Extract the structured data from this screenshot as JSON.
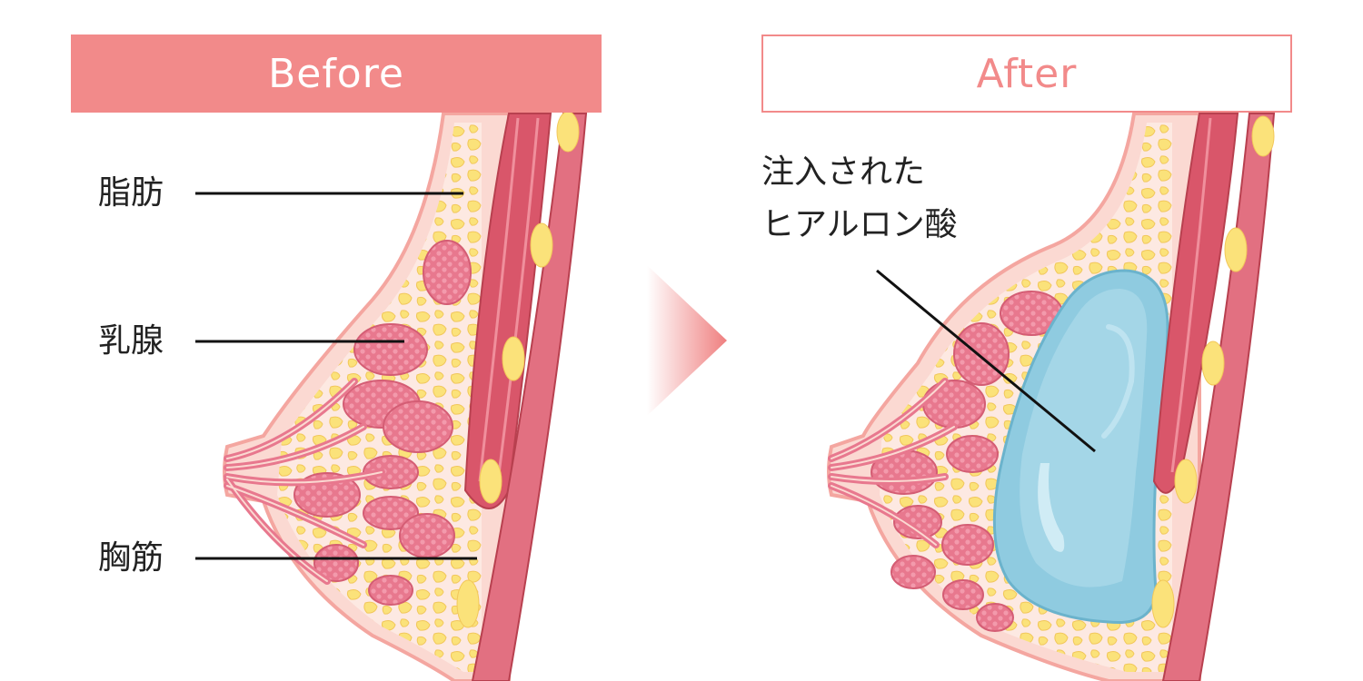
{
  "before": {
    "header": "Before",
    "labels": {
      "fat": "脂肪",
      "mammary_gland": "乳腺",
      "pectoral_muscle": "胸筋"
    }
  },
  "after": {
    "header": "After",
    "injected_label_line1": "注入された",
    "injected_label_line2": "ヒアルロン酸"
  },
  "colors": {
    "header_fill": "#f28a8a",
    "skin": "#fbd9d2",
    "skin_outline": "#f4a6a0",
    "fat": "#fbe27a",
    "gland": "#e8788e",
    "muscle": "#d9566a",
    "hyaluronic_acid": "#8fcbe0"
  }
}
